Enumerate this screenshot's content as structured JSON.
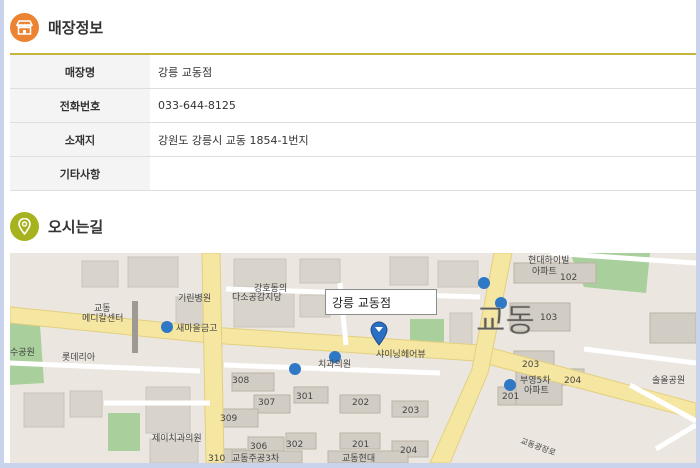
{
  "store_info": {
    "title": "매장정보",
    "rows": [
      {
        "label": "매장명",
        "value": "강릉 교동점"
      },
      {
        "label": "전화번호",
        "value": "033-644-8125"
      },
      {
        "label": "소재지",
        "value": "강원도 강릉시 교동 1854-1번지"
      },
      {
        "label": "기타사항",
        "value": ""
      }
    ]
  },
  "directions": {
    "title": "오시는길",
    "marker_label": "강릉 교동점",
    "places": {
      "hyundai_hillstate": "현대하이빌",
      "apartment": "아파트",
      "apt_102": "102",
      "apt_103": "103",
      "apt_203": "203",
      "apt_204": "204",
      "apt_201": "201",
      "apt_202": "202",
      "apt_203b": "203",
      "apt_201b": "201",
      "apt_204b": "204",
      "apt_301": "301",
      "apt_302": "302",
      "apt_306": "306",
      "apt_307": "307",
      "apt_308": "308",
      "apt_309": "309",
      "apt_310": "310",
      "buyoung": "부영5차",
      "buyoung_apt": "아파트",
      "solol_park": "솔올공원",
      "gyodong": "교동",
      "medical_center": "메디칼센터",
      "kirin_hospital": "기린병원",
      "gangho_church": "강호동의",
      "daso": "다소공감지당",
      "saemaeul": "새마을금고",
      "lotteria": "롯데리아",
      "dental": "치과의원",
      "shining_hair": "샤이닝헤어뷰",
      "jeil_dental": "제이치과의원",
      "gyodong_apt3": "교동주공3차",
      "gyodong_hyundai": "교동현대",
      "park_left": "수공원",
      "gyodong_big": "교동",
      "road_label": "교동광장로"
    }
  }
}
